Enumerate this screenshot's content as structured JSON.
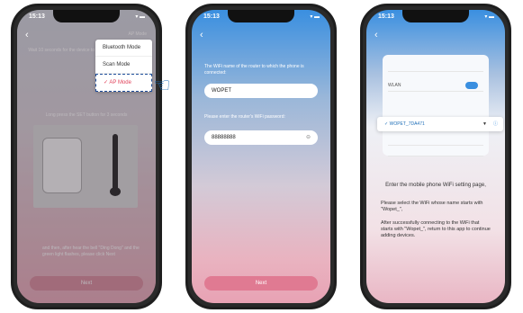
{
  "status": {
    "time": "15:13"
  },
  "phone1": {
    "header_right": "AP Mode",
    "top_text": "Wait 10 seconds for the device to enter the Router mode...",
    "mid_text": "Long press the SET button for 3 seconds",
    "bottom_text": "and then, after hear the bell \"Ding Dong\" and the green light flashes, please click Next",
    "next_label": "Next",
    "menu": [
      "Bluetooth Mode",
      "Scan Mode",
      "AP Mode"
    ],
    "menu_selected_index": 2
  },
  "phone2": {
    "prompt_wifi": "The WiFi name of the router to which the phone is connected:",
    "wifi_value": "WOPET",
    "prompt_password": "Please enter the router's WiFi password:",
    "password_value": "88888888",
    "next_label": "Next"
  },
  "phone3": {
    "wlan_label": "WLAN",
    "selected_network": "WOPET_7DA471",
    "enter_title": "Enter the mobile phone WiFi setting page,",
    "line1": "Please select the WiFi whose name starts with \"Wopet_\",",
    "line2": "After successfully connecting to the WiFi that starts with \"Wopet_\", return to this app to continue adding devices."
  },
  "colors": {
    "accent": "#3a8fe0",
    "button": "#e07a92",
    "hand": "#1f6fb8"
  }
}
